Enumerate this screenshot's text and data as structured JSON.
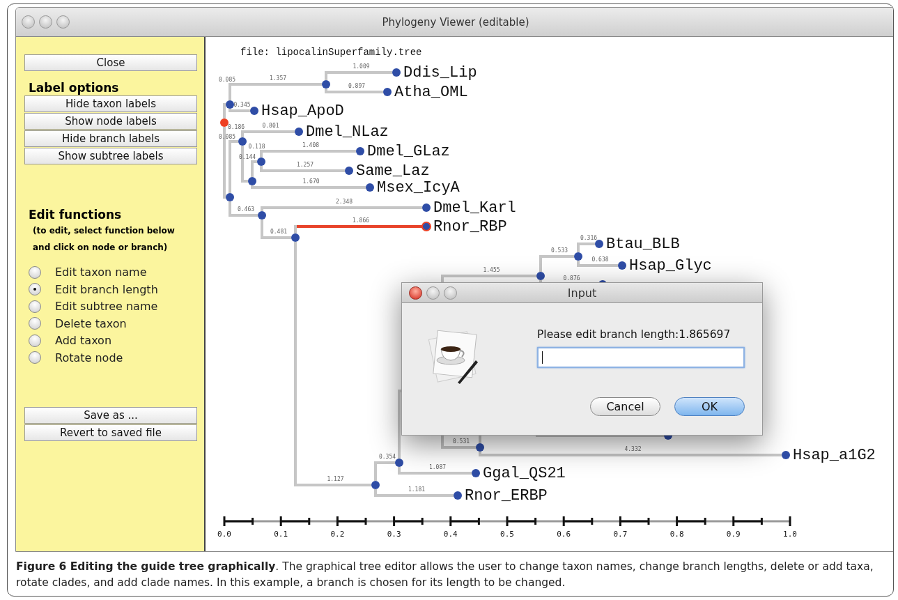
{
  "window": {
    "title": "Phylogeny Viewer (editable)"
  },
  "sidebar": {
    "close_button": "Close",
    "label_options": {
      "heading": "Label options",
      "buttons": [
        "Hide taxon labels",
        "Show node labels",
        "Hide branch labels",
        "Show subtree labels"
      ]
    },
    "edit_functions": {
      "heading": "Edit functions",
      "hint": "(to edit, select function below and click on node or branch)",
      "options": [
        {
          "label": "Edit taxon name",
          "selected": false
        },
        {
          "label": "Edit branch length",
          "selected": true
        },
        {
          "label": "Edit subtree name",
          "selected": false
        },
        {
          "label": "Delete taxon",
          "selected": false
        },
        {
          "label": "Add taxon",
          "selected": false
        },
        {
          "label": "Rotate node",
          "selected": false
        }
      ]
    },
    "file_buttons": [
      "Save as ...",
      "Revert to saved file"
    ]
  },
  "canvas": {
    "file_label": "file: lipocalinSuperfamily.tree",
    "tree": {
      "selected": false,
      "children": [
        {
          "branch_label": "0.085",
          "selected": false,
          "children": [
            {
              "branch_label": "1.357",
              "selected": false,
              "children": [
                {
                  "name": "Ddis_Lip",
                  "branch_label": "1.009",
                  "selected": false
                },
                {
                  "name": "Atha_OML",
                  "branch_label": "0.897",
                  "selected": false
                }
              ]
            },
            {
              "name": "Hsap_ApoD",
              "branch_label": "0.345",
              "selected": false
            }
          ]
        },
        {
          "branch_label": "0.085",
          "selected": false,
          "children": [
            {
              "branch_label": "0.186",
              "selected": false,
              "children": [
                {
                  "name": "Dmel_NLaz",
                  "branch_label": "0.801",
                  "selected": false
                },
                {
                  "branch_label": "0.144",
                  "selected": false,
                  "children": [
                    {
                      "branch_label": "0.118",
                      "selected": false,
                      "children": [
                        {
                          "name": "Dmel_GLaz",
                          "branch_label": "1.408",
                          "selected": false
                        },
                        {
                          "name": "Same_Laz",
                          "branch_label": "1.257",
                          "selected": false
                        }
                      ]
                    },
                    {
                      "name": "Msex_IcyA",
                      "branch_label": "1.670",
                      "selected": false
                    }
                  ]
                }
              ]
            },
            {
              "branch_label": "0.463",
              "selected": false,
              "children": [
                {
                  "name": "Dmel_Karl",
                  "branch_label": "2.348",
                  "selected": false
                },
                {
                  "branch_label": "0.481",
                  "selected": false,
                  "children": [
                    {
                      "name": "Rnor_RBP",
                      "branch_label": "1.866",
                      "selected": true
                    },
                    {
                      "branch_label": "1.127",
                      "selected": false,
                      "children": [
                        {
                          "branch_label": "0.354",
                          "selected": false,
                          "children": [
                            {
                              "children": [
                                {
                                  "branch_label": "1.455",
                                  "selected": false,
                                  "children": [
                                    {
                                      "branch_label": "0.533",
                                      "selected": false,
                                      "children": [
                                        {
                                          "name": "Btau_BLB",
                                          "branch_label": "0.316",
                                          "selected": false
                                        },
                                        {
                                          "name": "Hsap_Glyc",
                                          "branch_label": "0.638",
                                          "selected": false
                                        }
                                      ]
                                    },
                                    {
                                      "branch_label": "0.876",
                                      "selected": false
                                    }
                                  ]
                                },
                                {
                                  "branch_label": "0.531",
                                  "selected": false,
                                  "children": [
                                    {
                                      "children": [
                                        {
                                          "selected": false
                                        }
                                      ]
                                    },
                                    {
                                      "name": "Hsap_a1G2",
                                      "branch_label": "4.332",
                                      "selected": false
                                    }
                                  ]
                                }
                              ]
                            },
                            {
                              "name": "Ggal_QS21",
                              "branch_label": "1.087",
                              "selected": false
                            }
                          ]
                        },
                        {
                          "name": "Rnor_ERBP",
                          "branch_label": "1.181",
                          "selected": false
                        }
                      ]
                    }
                  ]
                }
              ]
            }
          ]
        }
      ]
    },
    "scale_bar": {
      "labels": [
        "0.0",
        "0.1",
        "0.2",
        "0.3",
        "0.4",
        "0.5",
        "0.6",
        "0.7",
        "0.8",
        "0.9",
        "1.0"
      ]
    }
  },
  "dialog": {
    "title": "Input",
    "prompt": "Please edit branch length:1.865697",
    "buttons": [
      {
        "label": "Cancel",
        "default": false
      },
      {
        "label": "OK",
        "default": true
      }
    ]
  },
  "caption": "**Figure 6 Editing the guide tree graphically**. The graphical tree editor allows the user to change taxon names, change branch lengths, delete or add taxa, rotate clades, and add clade names. In this example, a branch is chosen for its length to be changed."
}
